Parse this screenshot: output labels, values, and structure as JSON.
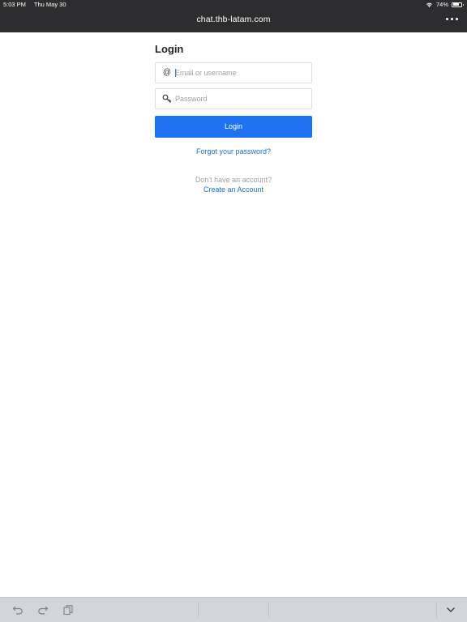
{
  "status_bar": {
    "time": "5:03 PM",
    "date": "Thu May 30",
    "battery": "74%",
    "battery_level": 0.74
  },
  "browser": {
    "title": "chat.thb-latam.com",
    "more_icon": "ellipsis-icon"
  },
  "login": {
    "heading": "Login",
    "email_placeholder": "Email or username",
    "email_icon": "at-icon",
    "password_placeholder": "Password",
    "password_icon": "key-icon",
    "submit_label": "Login",
    "forgot_link": "Forgot your password?",
    "no_account_text": "Don't have an account?",
    "create_link": "Create an Account"
  },
  "keyboard_bar": {
    "icons": [
      "undo-icon",
      "redo-icon",
      "paste-icon",
      "dismiss-keyboard-icon"
    ]
  },
  "colors": {
    "topbar": "#2d2d2f",
    "accent": "#1e72f0",
    "link": "#1e6ee6",
    "keyboard_bar": "#d3d5da"
  }
}
